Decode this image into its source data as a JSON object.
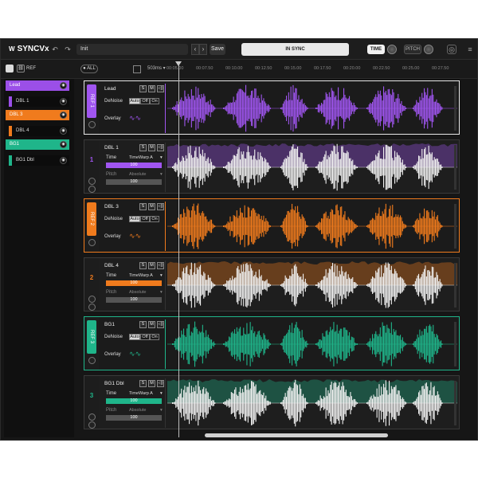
{
  "app": {
    "title": "SYNCVx",
    "preset": "Init",
    "save_label": "Save",
    "status": "IN SYNC",
    "time_label": "TIME",
    "pitch_label": "PITCH"
  },
  "toolbar": {
    "ref_label": "REF",
    "all_label": "ALL",
    "zoom": "503ms"
  },
  "timeline": [
    "00:05.00",
    "00:07.50",
    "00:10.00",
    "00:12.50",
    "00:15.00",
    "00:17.50",
    "00:20.00",
    "00:22.50",
    "00:25.00",
    "00:27.50"
  ],
  "sidebar": [
    {
      "label": "Lead",
      "color": "#9b4fe8"
    },
    {
      "label": "DBL 1",
      "color": "#9b4fe8"
    },
    {
      "label": "DBL 3",
      "color": "#f07b1d"
    },
    {
      "label": "DBL 4",
      "color": "#f07b1d"
    },
    {
      "label": "BG1",
      "color": "#1fb58a"
    },
    {
      "label": "BG1 Dbl",
      "color": "#1fb58a"
    }
  ],
  "tracks": [
    {
      "name": "Lead",
      "tag": "REF 1",
      "type": "ref",
      "color": "#a055f0",
      "denoise_label": "DeNoise",
      "auto": "Auto",
      "off": "Off",
      "on": "On",
      "overlay_label": "Overlay"
    },
    {
      "name": "DBL 1",
      "tag": "1",
      "type": "dbl",
      "color": "#a055f0",
      "time_label": "Time",
      "time_mode": "TimeWarp A",
      "time_value": "100",
      "pitch_label": "Pitch",
      "pitch_mode": "Absolute",
      "pitch_value": "100"
    },
    {
      "name": "DBL 3",
      "tag": "REF 2",
      "type": "ref",
      "color": "#f07b1d",
      "denoise_label": "DeNoise",
      "auto": "Auto",
      "off": "Off",
      "on": "On",
      "overlay_label": "Overlay"
    },
    {
      "name": "DBL 4",
      "tag": "2",
      "type": "dbl",
      "color": "#f07b1d",
      "time_label": "Time",
      "time_mode": "TimeWarp A",
      "time_value": "100",
      "pitch_label": "Pitch",
      "pitch_mode": "Absolute",
      "pitch_value": "100"
    },
    {
      "name": "BG1",
      "tag": "REF 3",
      "type": "ref",
      "color": "#1fb58a",
      "denoise_label": "DeNoise",
      "auto": "Auto",
      "off": "Off",
      "on": "On",
      "overlay_label": "Overlay"
    },
    {
      "name": "BG1 Dbl",
      "tag": "3",
      "type": "dbl",
      "color": "#1fb58a",
      "time_label": "Time",
      "time_mode": "TimeWarp A",
      "time_value": "100",
      "pitch_label": "Pitch",
      "pitch_mode": "Absolute",
      "pitch_value": "100"
    }
  ]
}
